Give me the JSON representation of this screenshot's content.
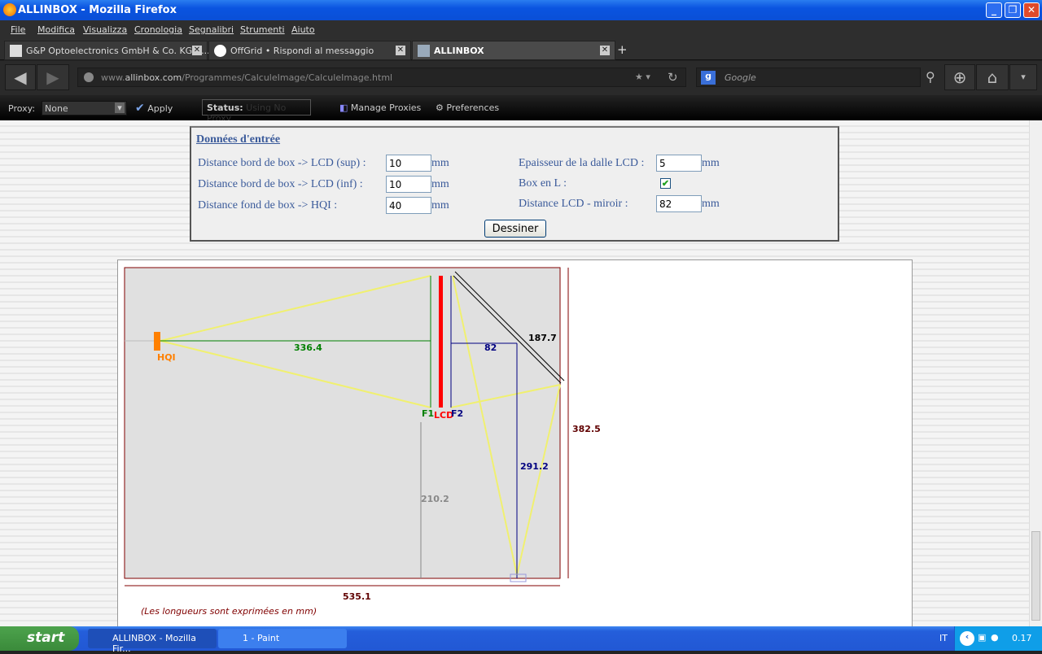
{
  "window": {
    "title": "ALLINBOX - Mozilla Firefox"
  },
  "menu": [
    "File",
    "Modifica",
    "Visualizza",
    "Cronologia",
    "Segnalibri",
    "Strumenti",
    "Aiuto"
  ],
  "tabs": [
    {
      "label": "G&P Optoelectronics GmbH & Co. KG - ..."
    },
    {
      "label": "OffGrid • Rispondi al messaggio"
    },
    {
      "label": "ALLINBOX"
    }
  ],
  "nav": {
    "url_prefix": "www.",
    "url_domain": "allinbox.com",
    "url_path": "/Programmes/CalculeImage/CalculeImage.html",
    "search_placeholder": "Google"
  },
  "proxybar": {
    "proxy_label": "Proxy:",
    "proxy_value": "None",
    "apply": "Apply",
    "status_label": "Status:",
    "status_value": "Using No Proxy",
    "manage": "Manage Proxies",
    "preferences": "Preferences"
  },
  "form": {
    "title": "Données d'entrée",
    "unit": "mm",
    "fields_left": [
      {
        "label": "Distance bord de box -> LCD (sup) :",
        "value": "10"
      },
      {
        "label": "Distance bord de box -> LCD (inf) :",
        "value": "10"
      },
      {
        "label": "Distance fond de box -> HQI :",
        "value": "40"
      }
    ],
    "epaisseur": {
      "label": "Epaisseur de la dalle LCD :",
      "value": "5"
    },
    "box_l": {
      "label": "Box en L :",
      "checked": true
    },
    "miroir": {
      "label": "Distance LCD - miroir :",
      "value": "82"
    },
    "button": "Dessiner"
  },
  "diagram": {
    "labels": {
      "hqi": "HQI",
      "lcd": "LCD",
      "f1": "F1",
      "f2": "F2"
    },
    "dimensions": {
      "hqi_f1": "336.4",
      "lcd_mirror": "82",
      "mirror": "187.7",
      "height": "382.5",
      "f2_bottom": "291.2",
      "bottom_f1": "210.2",
      "width": "535.1"
    },
    "note": "(Les longueurs sont exprimées en mm)",
    "colors": {
      "box": "#800000",
      "light": "#f0f070",
      "lamp": "#ff8000",
      "lcd": "#ff0000",
      "f1": "#008000",
      "f2": "#000080"
    }
  },
  "taskbar": {
    "start": "start",
    "tasks": [
      "ALLINBOX - Mozilla Fir...",
      "1 - Paint"
    ],
    "lang": "IT",
    "clock": "0.17"
  }
}
